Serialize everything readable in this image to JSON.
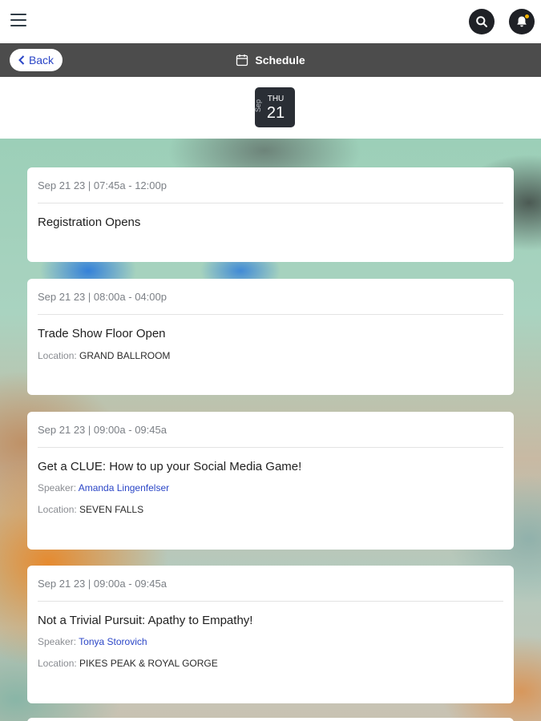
{
  "header": {
    "menu_icon": "hamburger-icon",
    "search_icon": "search-icon",
    "notification_icon": "bell-icon",
    "notification_badge_color": "#f5b400"
  },
  "nav": {
    "back_label": "Back",
    "title": "Schedule",
    "title_icon": "calendar-icon"
  },
  "date": {
    "month": "Sep",
    "weekday": "THU",
    "day": "21"
  },
  "sessions": [
    {
      "time": "Sep 21 23 | 07:45a - 12:00p",
      "title": "Registration Opens"
    },
    {
      "time": "Sep 21 23 | 08:00a - 04:00p",
      "title": "Trade Show Floor Open",
      "location_label": "Location:",
      "location": "GRAND BALLROOM"
    },
    {
      "time": "Sep 21 23 | 09:00a - 09:45a",
      "title": "Get a CLUE: How to up your Social Media Game!",
      "speaker_label": "Speaker:",
      "speaker": "Amanda Lingenfelser",
      "location_label": "Location:",
      "location": "SEVEN FALLS"
    },
    {
      "time": "Sep 21 23 | 09:00a - 09:45a",
      "title": "Not a Trivial Pursuit: Apathy to Empathy!",
      "speaker_label": "Speaker:",
      "speaker": "Tonya Storovich",
      "location_label": "Location:",
      "location": "PIKES PEAK & ROYAL GORGE"
    }
  ]
}
